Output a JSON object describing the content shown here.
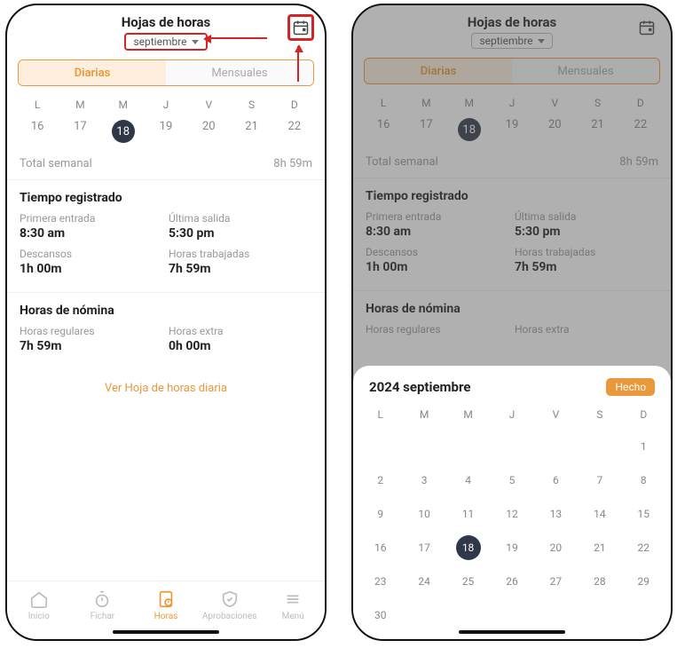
{
  "header": {
    "title": "Hojas de horas",
    "month_label": "septiembre"
  },
  "tabs": {
    "daily": "Diarias",
    "monthly": "Mensuales"
  },
  "week": {
    "dow": [
      "L",
      "M",
      "M",
      "J",
      "V",
      "S",
      "D"
    ],
    "days": [
      "16",
      "17",
      "18",
      "19",
      "20",
      "21",
      "22"
    ],
    "selected_index": 2
  },
  "totals": {
    "label": "Total semanal",
    "value": "8h 59m"
  },
  "registered": {
    "title": "Tiempo registrado",
    "first_in_label": "Primera entrada",
    "first_in_value": "8:30 am",
    "last_out_label": "Última salida",
    "last_out_value": "5:30 pm",
    "breaks_label": "Descansos",
    "breaks_value": "1h 00m",
    "worked_label": "Horas trabajadas",
    "worked_value": "7h 59m"
  },
  "payroll": {
    "title": "Horas de nómina",
    "regular_label": "Horas regulares",
    "regular_value": "7h 59m",
    "extra_label": "Horas extra",
    "extra_value": "0h 00m"
  },
  "link": {
    "view_daily": "Ver Hoja de horas diaria"
  },
  "nav": {
    "home": "Inicio",
    "punch": "Fichar",
    "hours": "Horas",
    "approvals": "Aprobaciones",
    "menu": "Menú"
  },
  "picker": {
    "title": "2024 septiembre",
    "done": "Hecho",
    "dow": [
      "L",
      "M",
      "M",
      "J",
      "V",
      "S",
      "D"
    ],
    "rows": [
      [
        "",
        "",
        "",
        "",
        "",
        "",
        "1"
      ],
      [
        "2",
        "3",
        "4",
        "5",
        "6",
        "7",
        "8"
      ],
      [
        "9",
        "10",
        "11",
        "12",
        "13",
        "14",
        "15"
      ],
      [
        "16",
        "17",
        "18",
        "19",
        "20",
        "21",
        "22"
      ],
      [
        "23",
        "24",
        "25",
        "26",
        "27",
        "28",
        "29"
      ],
      [
        "30",
        "",
        "",
        "",
        "",
        "",
        ""
      ]
    ],
    "selected_day": "18"
  }
}
